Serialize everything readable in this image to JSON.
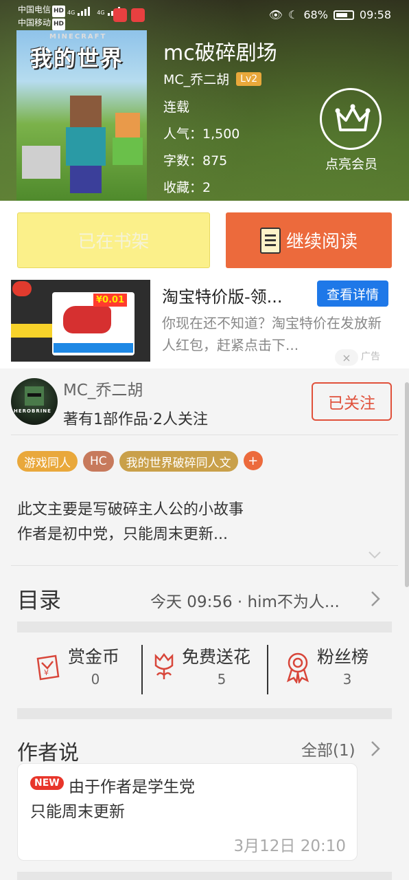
{
  "status_bar": {
    "carrier1": "中国电信",
    "carrier2": "中国移动",
    "hd": "HD",
    "net1": "4G",
    "net2": "4G",
    "battery": "68%",
    "time": "09:58"
  },
  "book": {
    "cover_brand": "MINECRAFT",
    "cover_title": "我的世界",
    "title": "mc破碎剧场",
    "author": "MC_乔二胡",
    "level": "Lv2",
    "status": "连载",
    "popularity": "人气：1,500",
    "word_count": "字数：875",
    "favorites": "收藏：2"
  },
  "vip": {
    "label": "点亮会员"
  },
  "actions": {
    "shelf_label": "已在书架",
    "read_label": "继续阅读"
  },
  "ad": {
    "title": "淘宝特价版-领...",
    "cta": "查看详情",
    "description": "你现在还不知道？淘宝特价在发放新人红包，赶紧点击下...",
    "close": "×",
    "mark": "广告",
    "image_price": "¥0.01"
  },
  "author_card": {
    "name": "MC_乔二胡",
    "meta": "著有1部作品·2人关注",
    "follow_label": "已关注",
    "avatar_text": "HEROBRINE"
  },
  "tags": [
    {
      "label": "游戏同人",
      "color": "#e9a83b"
    },
    {
      "label": "HC",
      "color": "#c77a5c"
    },
    {
      "label": "我的世界破碎同人文",
      "color": "#c9a04a"
    }
  ],
  "tag_add": "+",
  "description": {
    "line1": "此文主要是写破碎主人公的小故事",
    "line2": "作者是初中党，只能周末更新..."
  },
  "toc": {
    "title": "目录",
    "latest": "今天 09:56 · him不为人..."
  },
  "stats": [
    {
      "label": "赏金币",
      "value": "0",
      "icon": "red-envelope-icon"
    },
    {
      "label": "免费送花",
      "value": "5",
      "icon": "flower-icon"
    },
    {
      "label": "粉丝榜",
      "value": "3",
      "icon": "ribbon-medal-icon"
    }
  ],
  "author_says": {
    "title": "作者说",
    "all_label": "全部(1)",
    "badge": "NEW",
    "line1": "由于作者是学生党",
    "line2": "只能周末更新",
    "date": "3月12日   20:10"
  },
  "colors": {
    "accent": "#ec6a3c",
    "follow": "#e0503a",
    "shelf": "#fbf08a",
    "ad_cta": "#1e78e8",
    "level": "#e9a83b"
  }
}
